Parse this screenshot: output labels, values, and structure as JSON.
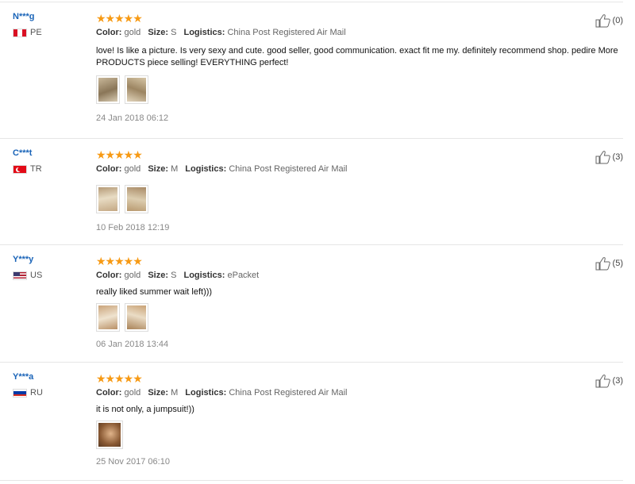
{
  "colors": {
    "username": "#1a64b8",
    "star": "#f79a14",
    "separator": "#e6e6e6"
  },
  "labels": {
    "color": "Color:",
    "size": "Size:",
    "logistics": "Logistics:"
  },
  "reviews": [
    {
      "username": "N***g",
      "country": "PE",
      "flag": "peru-flag",
      "stars": "★★★★★",
      "rating": 5,
      "color": "gold",
      "size": "S",
      "logistics": "China Post Registered Air Mail",
      "text": "love! Is like a picture. Is very sexy and cute. good seller, good communication. exact fit me my. definitely recommend shop. pedire More PRODUCTS piece selling! EVERYTHING perfect!",
      "photos": 2,
      "date": "24 Jan 2018 06:12",
      "likes": "(0)"
    },
    {
      "username": "C***t",
      "country": "TR",
      "flag": "turkey-flag",
      "stars": "★★★★★",
      "rating": 5,
      "color": "gold",
      "size": "M",
      "logistics": "China Post Registered Air Mail",
      "text": "",
      "photos": 2,
      "date": "10 Feb 2018 12:19",
      "likes": "(3)"
    },
    {
      "username": "Y***y",
      "country": "US",
      "flag": "usa-flag",
      "stars": "★★★★★",
      "rating": 5,
      "color": "gold",
      "size": "S",
      "logistics": "ePacket",
      "text": "really liked summer wait left)))",
      "photos": 2,
      "date": "06 Jan 2018 13:44",
      "likes": "(5)"
    },
    {
      "username": "Y***a",
      "country": "RU",
      "flag": "russia-flag",
      "stars": "★★★★★",
      "rating": 5,
      "color": "gold",
      "size": "M",
      "logistics": "China Post Registered Air Mail",
      "text": "it is not only, a jumpsuit!))",
      "photos": 1,
      "date": "25 Nov 2017 06:10",
      "likes": "(3)"
    }
  ]
}
